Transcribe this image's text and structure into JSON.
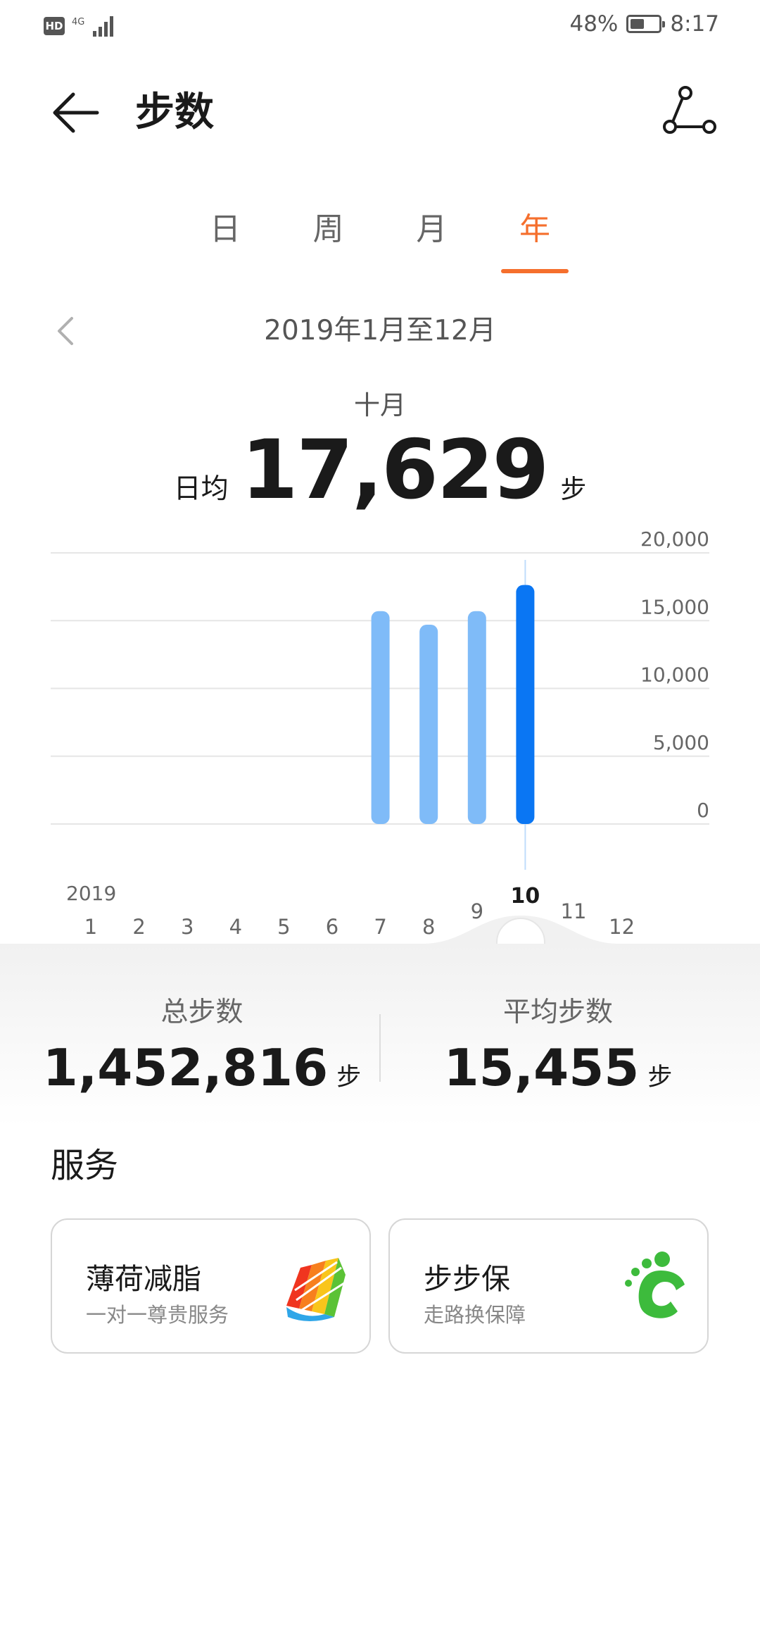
{
  "status_bar": {
    "hd": "HD",
    "network": "4G",
    "battery_percent": "48%",
    "battery_level": 0.48,
    "time": "8:17"
  },
  "header": {
    "title": "步数",
    "back_icon": "arrow-left-icon",
    "share_icon": "route-share-icon"
  },
  "tabs": [
    {
      "label": "日",
      "active": false
    },
    {
      "label": "周",
      "active": false
    },
    {
      "label": "月",
      "active": false
    },
    {
      "label": "年",
      "active": true
    }
  ],
  "period": {
    "range": "2019年1月至12月",
    "prev_icon": "chevron-left-icon"
  },
  "summary": {
    "month": "十月",
    "prefix": "日均",
    "value": "17,629",
    "unit": "步"
  },
  "chart_data": {
    "type": "bar",
    "year_label": "2019",
    "categories": [
      "1",
      "2",
      "3",
      "4",
      "5",
      "6",
      "7",
      "8",
      "9",
      "10",
      "11",
      "12"
    ],
    "values": [
      0,
      0,
      0,
      0,
      0,
      0,
      15700,
      14700,
      15700,
      17629,
      0,
      0
    ],
    "selected": "10",
    "ylim": [
      0,
      20000
    ],
    "yticks": [
      "0",
      "5,000",
      "10,000",
      "15,000",
      "20,000"
    ],
    "ytick_values": [
      0,
      5000,
      10000,
      15000,
      20000
    ],
    "grid": true,
    "colors": {
      "bar": "#7fbbf8",
      "selected": "#0a76f3",
      "grid": "#e6e6e6"
    }
  },
  "stats": {
    "total_label": "总步数",
    "total_value": "1,452,816",
    "total_unit": "步",
    "avg_label": "平均步数",
    "avg_value": "15,455",
    "avg_unit": "步"
  },
  "services": {
    "title": "服务",
    "items": [
      {
        "title": "薄荷减脂",
        "subtitle": "一对一尊贵服务",
        "icon": "rainbow-leaf-icon"
      },
      {
        "title": "步步保",
        "subtitle": "走路换保障",
        "icon": "green-footprint-icon"
      }
    ]
  },
  "colors": {
    "accent": "#f56f2d"
  }
}
